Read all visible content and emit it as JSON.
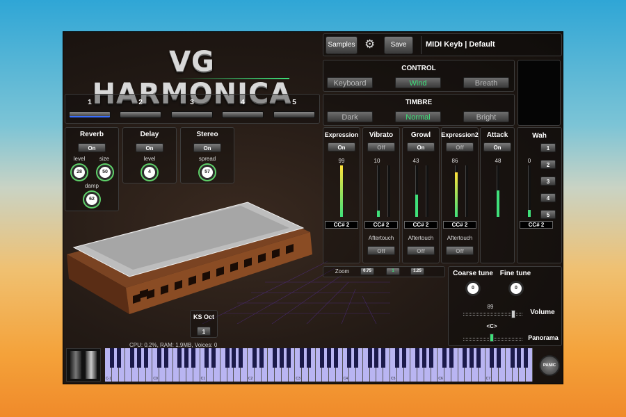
{
  "title": "VG HARMONICA",
  "toolbar": {
    "samples": "Samples",
    "save": "Save",
    "preset": "MIDI Keyb | Default"
  },
  "control": {
    "title": "CONTROL",
    "options": [
      "Keyboard",
      "Wind",
      "Breath"
    ],
    "selected": "Wind"
  },
  "timbre": {
    "title": "TIMBRE",
    "options": [
      "Dark",
      "Normal",
      "Bright"
    ],
    "selected": "Normal"
  },
  "slots": {
    "labels": [
      "1",
      "2",
      "3",
      "4",
      "5"
    ]
  },
  "reverb": {
    "title": "Reverb",
    "toggle": "On",
    "level_label": "level",
    "level": "28",
    "size_label": "size",
    "size": "50",
    "damp_label": "damp",
    "damp": "62"
  },
  "delay": {
    "title": "Delay",
    "toggle": "On",
    "level_label": "level",
    "level": "4"
  },
  "stereo": {
    "title": "Stereo",
    "toggle": "On",
    "spread_label": "spread",
    "spread": "57"
  },
  "channels": [
    {
      "title": "Expression",
      "toggle": "On",
      "value": "99",
      "cc": "CC# 2"
    },
    {
      "title": "Vibrato",
      "toggle": "Off",
      "value": "10",
      "cc": "CC# 2",
      "after_label": "Aftertouch",
      "after": "Off"
    },
    {
      "title": "Growl",
      "toggle": "On",
      "value": "43",
      "cc": "CC# 2",
      "after_label": "Aftertouch",
      "after": "Off"
    },
    {
      "title": "Expression2",
      "toggle": "Off",
      "value": "86",
      "cc": "CC# 2",
      "after_label": "Aftertouch",
      "after": "Off"
    },
    {
      "title": "Attack",
      "toggle": "On",
      "value": "48"
    }
  ],
  "wah": {
    "title": "Wah",
    "value": "0",
    "cc": "CC# 2",
    "buttons": [
      "1",
      "2",
      "3",
      "4",
      "5"
    ]
  },
  "zoom": {
    "label": "Zoom",
    "options": [
      "0.75",
      "1",
      "1.25"
    ]
  },
  "tune": {
    "coarse_label": "Coarse tune",
    "coarse": "0",
    "fine_label": "Fine tune",
    "fine": "0"
  },
  "volume": {
    "label": "Volume",
    "value": "89"
  },
  "pan": {
    "label": "Panorama",
    "value": "<C>"
  },
  "ks": {
    "label": "KS Oct",
    "value": "1"
  },
  "status": "CPU: 0.2%, RAM: 1.9MB, Voices: 0",
  "panic": "PANIC",
  "octaves": [
    "C-1",
    "C0",
    "C1",
    "C2",
    "C3",
    "C4",
    "C5",
    "C6",
    "C7"
  ],
  "colors": {
    "accent": "#3fe07a",
    "keys": "#b9b5f2"
  }
}
